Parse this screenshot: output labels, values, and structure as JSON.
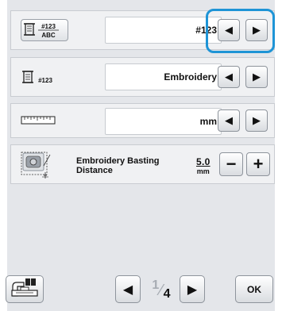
{
  "rows": {
    "color_name": {
      "icon": "thread-spool-number-abc-icon",
      "icon_text_top": "#123",
      "icon_text_bottom": "ABC",
      "value": "#123"
    },
    "thread_brand": {
      "icon": "thread-spool-number-icon",
      "icon_text": "#123",
      "value": "Embroidery"
    },
    "units": {
      "icon": "ruler-icon",
      "value": "mm"
    },
    "basting_distance": {
      "icon": "basting-frame-icon",
      "label_line1": "Embroidery Basting",
      "label_line2": "Distance",
      "value": "5.0",
      "unit": "mm",
      "minus_label": "−",
      "plus_label": "+"
    }
  },
  "arrows": {
    "left": "◀",
    "right": "▶"
  },
  "footer": {
    "page_current": "1",
    "page_total": "4",
    "ok_label": "OK",
    "left_icon": "embroidery-machine-icon"
  },
  "colors": {
    "highlight": "#1e94d6",
    "background": "#e4e6ea",
    "row": "#f0f1f3"
  }
}
